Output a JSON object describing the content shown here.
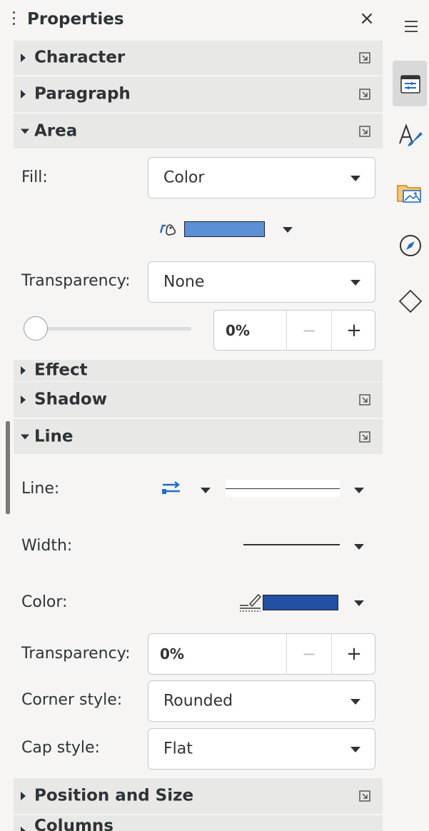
{
  "panel": {
    "title": "Properties",
    "close_symbol": "×"
  },
  "sections": {
    "character": "Character",
    "paragraph": "Paragraph",
    "area": "Area",
    "effect": "Effect",
    "shadow": "Shadow",
    "line": "Line",
    "position_size": "Position and Size",
    "columns": "Columns"
  },
  "area": {
    "fill_label": "Fill:",
    "fill_value": "Color",
    "fill_color": "#5b8fd6",
    "transparency_label": "Transparency:",
    "transparency_value": "None",
    "transparency_percent": "0%",
    "slider_value": 0
  },
  "line": {
    "line_label": "Line:",
    "width_label": "Width:",
    "color_label": "Color:",
    "line_color": "#2150a5",
    "transparency_label": "Transparency:",
    "transparency_value": "0%",
    "corner_label": "Corner style:",
    "corner_value": "Rounded",
    "cap_label": "Cap style:",
    "cap_value": "Flat"
  },
  "spin": {
    "minus": "−",
    "plus": "+"
  },
  "tabbar": {
    "items": [
      "menu-icon",
      "properties-icon",
      "styles-icon",
      "gallery-icon",
      "navigator-icon",
      "shapes-icon"
    ],
    "accent": "#1e6fc9"
  }
}
